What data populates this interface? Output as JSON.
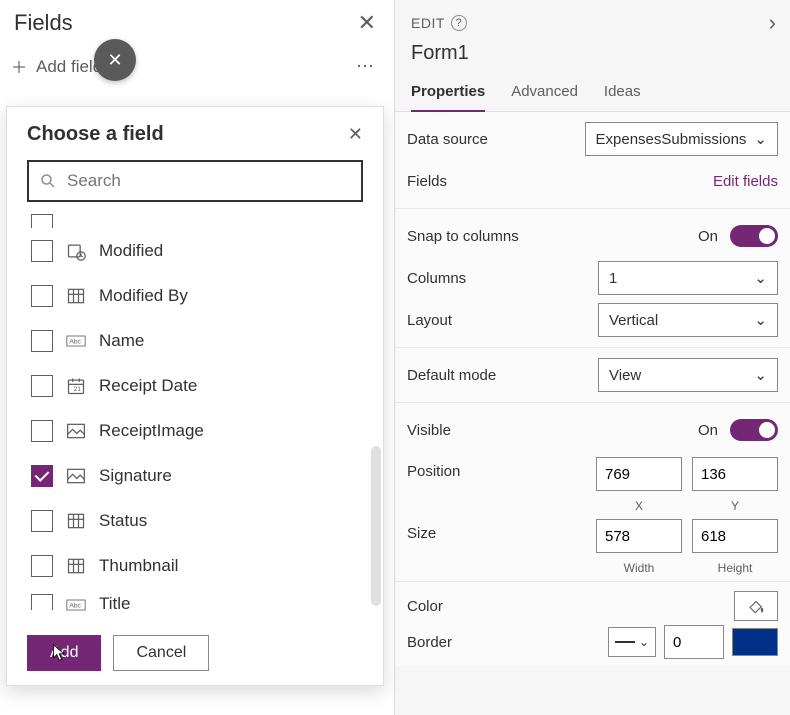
{
  "leftPane": {
    "title": "Fields",
    "addField": "Add field"
  },
  "popup": {
    "title": "Choose a field",
    "searchPlaceholder": "Search",
    "cutoffTopLabel": "",
    "fields": [
      {
        "label": "Modified",
        "type": "datetime",
        "checked": false
      },
      {
        "label": "Modified By",
        "type": "lookup",
        "checked": false
      },
      {
        "label": "Name",
        "type": "text",
        "checked": false
      },
      {
        "label": "Receipt Date",
        "type": "date",
        "checked": false
      },
      {
        "label": "ReceiptImage",
        "type": "image",
        "checked": false
      },
      {
        "label": "Signature",
        "type": "image",
        "checked": true
      },
      {
        "label": "Status",
        "type": "lookup",
        "checked": false
      },
      {
        "label": "Thumbnail",
        "type": "lookup",
        "checked": false
      },
      {
        "label": "Title",
        "type": "text",
        "checked": false
      }
    ],
    "addBtn": "Add",
    "cancelBtn": "Cancel"
  },
  "rightPane": {
    "editLabel": "EDIT",
    "formName": "Form1",
    "tabs": {
      "properties": "Properties",
      "advanced": "Advanced",
      "ideas": "Ideas"
    },
    "rows": {
      "dataSourceLabel": "Data source",
      "dataSourceValue": "ExpensesSubmissions",
      "fieldsLabel": "Fields",
      "editFields": "Edit fields",
      "snapLabel": "Snap to columns",
      "snapState": "On",
      "columnsLabel": "Columns",
      "columnsValue": "1",
      "layoutLabel": "Layout",
      "layoutValue": "Vertical",
      "defaultModeLabel": "Default mode",
      "defaultModeValue": "View",
      "visibleLabel": "Visible",
      "visibleState": "On",
      "positionLabel": "Position",
      "posX": "769",
      "posY": "136",
      "xLabel": "X",
      "yLabel": "Y",
      "sizeLabel": "Size",
      "width": "578",
      "height": "618",
      "widthLabel": "Width",
      "heightLabel": "Height",
      "colorLabel": "Color",
      "borderLabel": "Border",
      "borderValue": "0"
    }
  }
}
